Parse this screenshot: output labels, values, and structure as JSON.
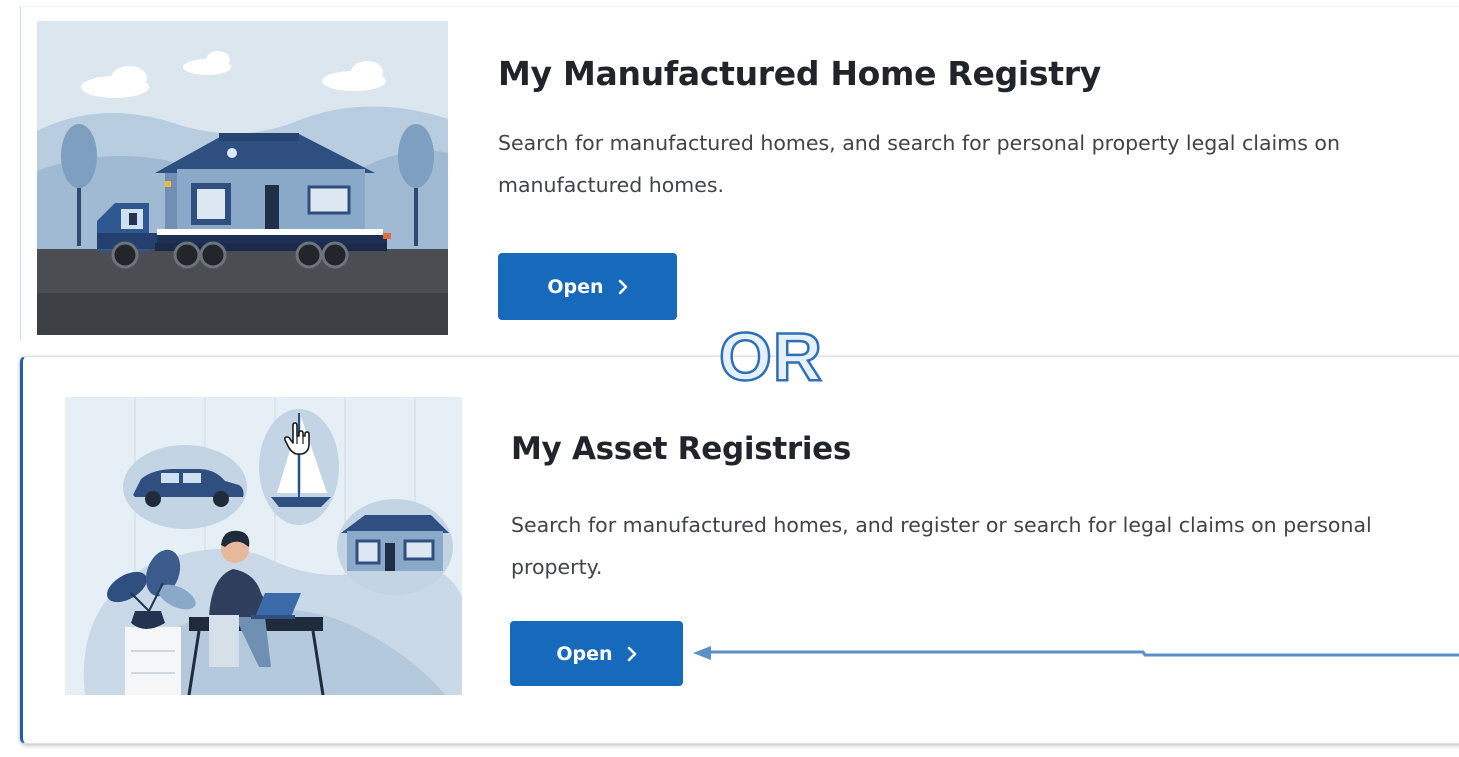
{
  "cards": {
    "mhr": {
      "title": "My Manufactured Home Registry",
      "description": "Search for manufactured homes, and search for personal property legal claims on manufactured homes.",
      "open_label": "Open",
      "illustration": "manufactured-home-on-truck-illustration"
    },
    "ppr": {
      "title": "My Asset Registries",
      "description": "Search for manufactured homes, and register or search for legal claims on personal property.",
      "open_label": "Open",
      "illustration": "person-at-laptop-with-assets-illustration"
    }
  },
  "annotation": {
    "separator_text": "OR",
    "arrow_color": "#5b8fc7"
  },
  "colors": {
    "button": "#1669bb",
    "accent_border": "#1f5fa8",
    "title_text": "#212529"
  }
}
